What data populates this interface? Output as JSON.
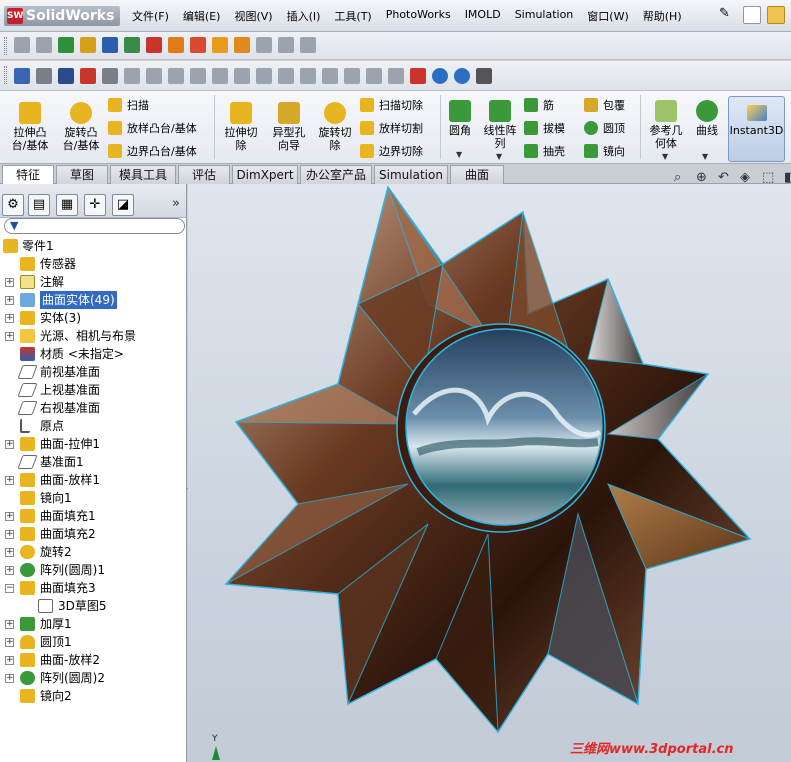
{
  "app": {
    "name": "SolidWorks"
  },
  "menu": [
    "文件(F)",
    "编辑(E)",
    "视图(V)",
    "插入(I)",
    "工具(T)",
    "PhotoWorks",
    "IMOLD",
    "Simulation",
    "窗口(W)",
    "帮助(H)"
  ],
  "ribbon": {
    "extrude_boss": "拉伸凸\n台/基体",
    "revolve_boss": "旋转凸\n台/基体",
    "sweep": "扫描",
    "loft_boss": "放样凸台/基体",
    "boundary_boss": "边界凸台/基体",
    "extrude_cut": "拉伸切\n除",
    "hole_wizard": "异型孔\n向导",
    "revolve_cut": "旋转切\n除",
    "sweep_cut": "扫描切除",
    "loft_cut": "放样切割",
    "boundary_cut": "边界切除",
    "fillet": "圆角",
    "linear_pattern": "线性阵\n列",
    "rib": "筋",
    "draft": "拔模",
    "shell": "抽壳",
    "wrap": "包覆",
    "dome": "圆顶",
    "mirror": "镜向",
    "ref_geometry": "参考几\n何体",
    "curves": "曲线",
    "instant3d": "Instant3D"
  },
  "tabs": [
    "特征",
    "草图",
    "模具工具",
    "评估",
    "DimXpert",
    "办公室产品",
    "Simulation",
    "曲面"
  ],
  "tree": [
    {
      "label": "零件1",
      "expander": "",
      "indent": 0
    },
    {
      "label": "传感器",
      "expander": ""
    },
    {
      "label": "注解",
      "expander": "+"
    },
    {
      "label": "曲面实体(49)",
      "expander": "+",
      "selected": true
    },
    {
      "label": "实体(3)",
      "expander": "+"
    },
    {
      "label": "光源、相机与布景",
      "expander": "+"
    },
    {
      "label": "材质 <未指定>",
      "expander": ""
    },
    {
      "label": "前视基准面",
      "expander": ""
    },
    {
      "label": "上视基准面",
      "expander": ""
    },
    {
      "label": "右视基准面",
      "expander": ""
    },
    {
      "label": "原点",
      "expander": ""
    },
    {
      "label": "曲面-拉伸1",
      "expander": "+"
    },
    {
      "label": "基准面1",
      "expander": ""
    },
    {
      "label": "曲面-放样1",
      "expander": "+"
    },
    {
      "label": "镜向1",
      "expander": ""
    },
    {
      "label": "曲面填充1",
      "expander": "+"
    },
    {
      "label": "曲面填充2",
      "expander": "+"
    },
    {
      "label": "旋转2",
      "expander": "+"
    },
    {
      "label": "阵列(圆周)1",
      "expander": "+"
    },
    {
      "label": "曲面填充3",
      "expander": "−"
    },
    {
      "label": "3D草图5",
      "expander": "",
      "child": true
    },
    {
      "label": "加厚1",
      "expander": "+"
    },
    {
      "label": "圆顶1",
      "expander": "+"
    },
    {
      "label": "曲面-放样2",
      "expander": "+"
    },
    {
      "label": "阵列(圆周)2",
      "expander": "+"
    },
    {
      "label": "镜向2",
      "expander": ""
    }
  ],
  "watermark": "三维网www.3dportal.cn",
  "axis_label": "Y"
}
